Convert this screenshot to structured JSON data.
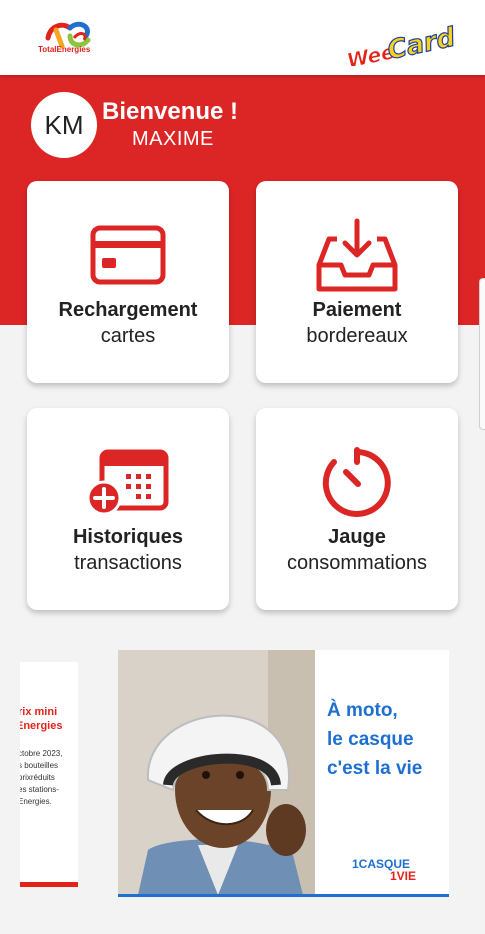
{
  "header": {
    "brand_name": "TotalEnergies",
    "app_logo_text": "WeeCard"
  },
  "hero": {
    "avatar_initials": "KM",
    "welcome": "Bienvenue !",
    "username": "MAXIME"
  },
  "tiles": [
    {
      "title": "Rechargement",
      "subtitle": "cartes",
      "icon": "credit-card-icon"
    },
    {
      "title": "Paiement",
      "subtitle": "bordereaux",
      "icon": "inbox-download-icon"
    },
    {
      "title": "Historiques",
      "subtitle": "transactions",
      "icon": "calendar-add-icon"
    },
    {
      "title": "Jauge",
      "subtitle": "consommations",
      "icon": "gauge-timer-icon"
    }
  ],
  "banners": {
    "prev": {
      "line1": "rix mini",
      "line2": "Energies",
      "small": [
        "ctobre 2023,",
        "s bouteilles",
        "prixréduits",
        "es stations-",
        "Energies."
      ]
    },
    "main": {
      "lines": [
        "À moto,",
        "le casque",
        "c'est la vie"
      ],
      "tag1": "1CASQUE",
      "tag2": "1VIE"
    }
  },
  "colors": {
    "primary_red": "#dc2626",
    "accent_blue": "#1f6fd1",
    "background": "#f3f3f3"
  }
}
